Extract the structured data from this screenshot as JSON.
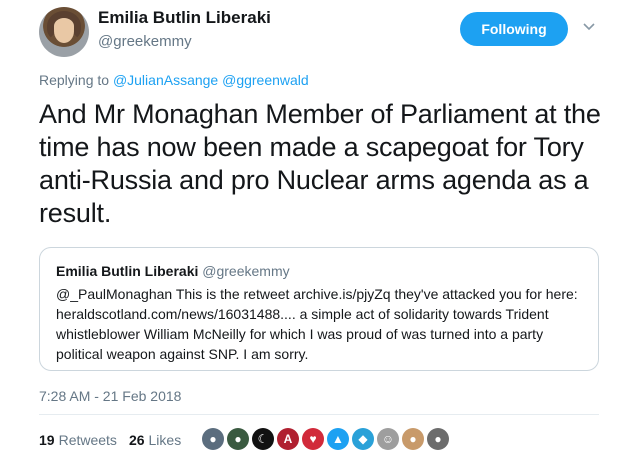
{
  "author": {
    "name": "Emilia Butlin Liberaki",
    "handle": "@greekemmy"
  },
  "follow_button": {
    "label": "Following",
    "color": "#1da1f2"
  },
  "reply": {
    "prefix": "Replying to",
    "mentions": [
      "@JulianAssange",
      "@ggreenwald"
    ]
  },
  "tweet": {
    "text": "And Mr Monaghan Member of Parliament at the time has now been made a scapegoat for Tory anti-Russia and pro Nuclear arms agenda as a result."
  },
  "quoted": {
    "name": "Emilia Butlin Liberaki",
    "handle": "@greekemmy",
    "text": "@_PaulMonaghan This is the retweet archive.is/pjyZq they've attacked you for here: heraldscotland.com/news/16031488.... a simple act of solidarity towards Trident whistleblower William McNeilly for which I was proud of was turned into a party political weapon against SNP. I am sorry."
  },
  "timestamp": "7:28 AM - 21 Feb 2018",
  "stats": {
    "retweets_count": "19",
    "retweets_label": "Retweets",
    "likes_count": "26",
    "likes_label": "Likes"
  },
  "likers": [
    {
      "icon": "avatar",
      "color": "#5b6d7e",
      "glyph": "●"
    },
    {
      "icon": "avatar",
      "color": "#3a5a40",
      "glyph": "●"
    },
    {
      "icon": "avatar",
      "color": "#111111",
      "glyph": "☾"
    },
    {
      "icon": "avatar",
      "color": "#b02030",
      "glyph": "A"
    },
    {
      "icon": "avatar",
      "color": "#d12a3a",
      "glyph": "♥"
    },
    {
      "icon": "avatar",
      "color": "#1da1f2",
      "glyph": "▲"
    },
    {
      "icon": "avatar",
      "color": "#2aa1d8",
      "glyph": "◆"
    },
    {
      "icon": "avatar",
      "color": "#9e9e9e",
      "glyph": "☺"
    },
    {
      "icon": "avatar",
      "color": "#c89a6a",
      "glyph": "●"
    },
    {
      "icon": "avatar",
      "color": "#6c6c6c",
      "glyph": "●"
    }
  ]
}
